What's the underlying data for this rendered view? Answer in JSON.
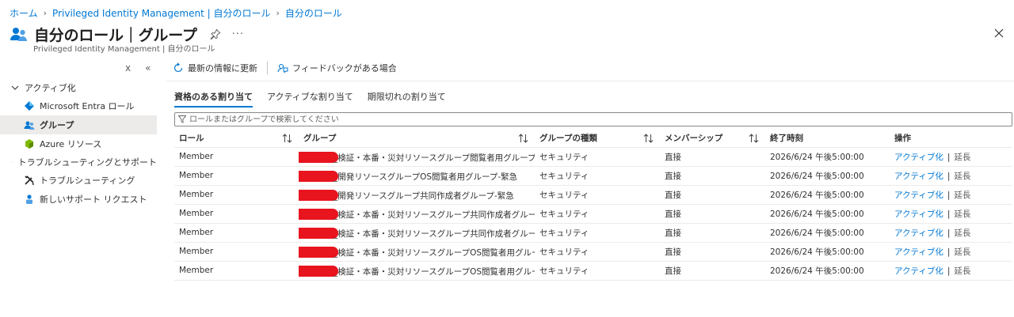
{
  "breadcrumb": [
    "ホーム",
    "Privileged Identity Management | 自分のロール",
    "自分のロール"
  ],
  "title": "自分のロール｜グループ",
  "subtitle": "Privileged Identity Management | 自分のロール",
  "sidebar": {
    "groups": [
      {
        "label": "アクティブ化",
        "items": [
          "Microsoft Entra ロール",
          "グループ",
          "Azure リソース"
        ]
      },
      {
        "label": "トラブルシューティングとサポート",
        "items": [
          "トラブルシューティング",
          "新しいサポート リクエスト"
        ]
      }
    ],
    "selected": "グループ"
  },
  "toolbar": {
    "refresh": "最新の情報に更新",
    "feedback": "フィードバックがある場合"
  },
  "tabs": [
    "資格のある割り当て",
    "アクティブな割り当て",
    "期限切れの割り当て"
  ],
  "filter": {
    "placeholder": "ロールまたはグループで検索してください"
  },
  "table": {
    "columns": [
      "ロール",
      "グループ",
      "グループの種類",
      "メンバーシップ",
      "終了時刻",
      "操作"
    ],
    "rows": [
      {
        "role": "Member",
        "group": "_検証・本番・災対リソースグループ閲覧者用グループ-緊急",
        "type": "セキュリティ",
        "membership": "直接",
        "end": "2026/6/24 午後5:00:00",
        "action1": "アクティブ化",
        "action2": "延長"
      },
      {
        "role": "Member",
        "group": "_開発リソースグループOS閲覧者用グループ-緊急",
        "type": "セキュリティ",
        "membership": "直接",
        "end": "2026/6/24 午後5:00:00",
        "action1": "アクティブ化",
        "action2": "延長"
      },
      {
        "role": "Member",
        "group": "_開発リソースグループ共同作成者グループ-緊急",
        "type": "セキュリティ",
        "membership": "直接",
        "end": "2026/6/24 午後5:00:00",
        "action1": "アクティブ化",
        "action2": "延長"
      },
      {
        "role": "Member",
        "group": "_検証・本番・災対リソースグループ共同作成者グループ-通常",
        "type": "セキュリティ",
        "membership": "直接",
        "end": "2026/6/24 午後5:00:00",
        "action1": "アクティブ化",
        "action2": "延長"
      },
      {
        "role": "Member",
        "group": "_検証・本番・災対リソースグループ共同作成者グループ-緊急",
        "type": "セキュリティ",
        "membership": "直接",
        "end": "2026/6/24 午後5:00:00",
        "action1": "アクティブ化",
        "action2": "延長"
      },
      {
        "role": "Member",
        "group": "_検証・本番・災対リソースグループOS閲覧者用グループ-通常",
        "type": "セキュリティ",
        "membership": "直接",
        "end": "2026/6/24 午後5:00:00",
        "action1": "アクティブ化",
        "action2": "延長"
      },
      {
        "role": "Member",
        "group": "_検証・本番・災対リソースグループOS閲覧者用グループ-緊急",
        "type": "セキュリティ",
        "membership": "直接",
        "end": "2026/6/24 午後5:00:00",
        "action1": "アクティブ化",
        "action2": "延長"
      }
    ]
  },
  "colors": {
    "accent": "#0078d4",
    "redaction": "#e8141e",
    "selected_bg": "#edebe9"
  }
}
